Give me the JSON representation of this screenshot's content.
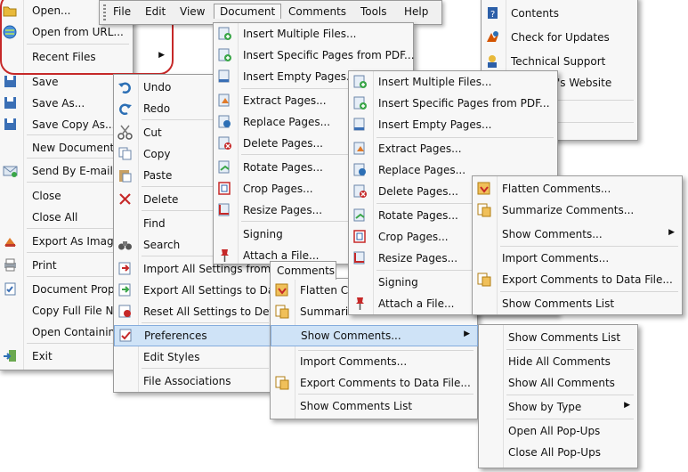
{
  "menubar": {
    "items": [
      "File",
      "Edit",
      "View",
      "Document",
      "Comments",
      "Tools",
      "Help"
    ]
  },
  "file_menu": {
    "items": [
      "Open...",
      "Open from URL...",
      "Recent Files",
      "Save",
      "Save As...",
      "Save Copy As...",
      "New Document...",
      "Send By E-mail",
      "Close",
      "Close All",
      "Export As Image F",
      "Print",
      "Document Prope",
      "Copy Full File Nar",
      "Open Containing",
      "Exit"
    ]
  },
  "edit_menu": {
    "items": [
      "Undo",
      "Redo",
      "Cut",
      "Copy",
      "Paste",
      "Delete",
      "Find",
      "Search",
      "Import All Settings from Da",
      "Export All Settings to Data F",
      "Reset All Settings to Defaul",
      "Preferences",
      "Edit Styles",
      "File Associations"
    ]
  },
  "document_menu": {
    "items": [
      "Insert Multiple Files...",
      "Insert Specific Pages from PDF...",
      "Insert Empty Pages...",
      "Extract Pages...",
      "Replace Pages...",
      "Delete Pages...",
      "Rotate Pages...",
      "Crop Pages...",
      "Resize Pages...",
      "Signing",
      "Attach a File..."
    ]
  },
  "document_menu2": {
    "items": [
      "Insert Multiple Files...",
      "Insert Specific Pages from PDF...",
      "Insert Empty Pages...",
      "Extract Pages...",
      "Replace Pages...",
      "Delete Pages...",
      "Rotate Pages...",
      "Crop Pages...",
      "Resize Pages...",
      "Signing",
      "Attach a File..."
    ]
  },
  "comments_tab": "Comments",
  "comments_menu": {
    "items": [
      "Flatten Co",
      "Summariz",
      "Show Comments...",
      "Import Comments...",
      "Export Comments to Data File...",
      "Show Comments List"
    ]
  },
  "comments_menu2": {
    "items": [
      "Flatten Comments...",
      "Summarize Comments...",
      "Show Comments...",
      "Import Comments...",
      "Export Comments to Data File...",
      "Show Comments List"
    ]
  },
  "show_comments_menu": {
    "items": [
      "Show Comments List",
      "Hide All Comments",
      "Show All Comments",
      "Show by Type",
      "Open All Pop-Ups",
      "Close All Pop-Ups"
    ]
  },
  "help_menu": {
    "items": [
      "Contents",
      "Check for Updates",
      "Technical Support",
      "'s Website"
    ]
  },
  "colors": {
    "highlight": "#cfe3f7",
    "highlight_border": "#84acdd",
    "red": "#c62828"
  }
}
